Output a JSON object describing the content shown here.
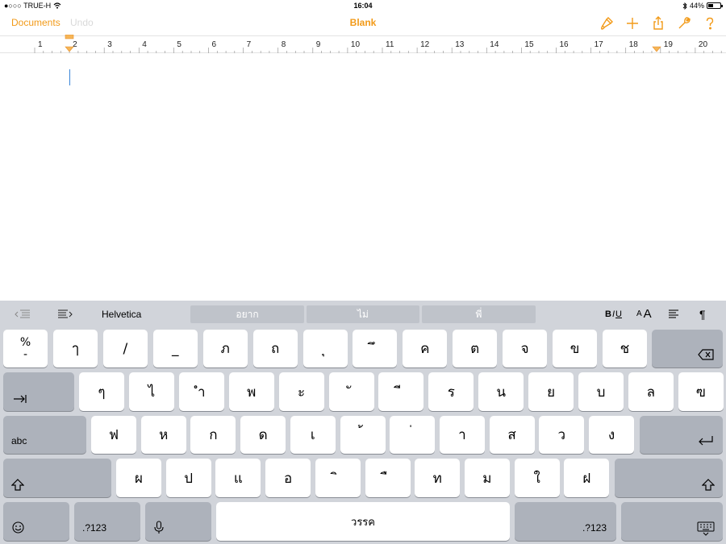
{
  "status": {
    "carrier": "●○○○ TRUE-H",
    "time": "16:04",
    "battery_pct": "44%",
    "battery_level": 0.44
  },
  "nav": {
    "documents": "Documents",
    "undo": "Undo",
    "title": "Blank"
  },
  "ruler": {
    "numbers": [
      "1",
      "2",
      "3",
      "4",
      "5",
      "6",
      "7",
      "8",
      "9",
      "10",
      "11",
      "12",
      "13",
      "14",
      "15",
      "16",
      "17",
      "18",
      "19",
      "20"
    ]
  },
  "shortcut": {
    "font": "Helvetica",
    "bold": "B",
    "italic": "I",
    "underline": "U",
    "size_small": "A",
    "size_large": "A",
    "pilcrow": "¶"
  },
  "suggestions": [
    "อยาก",
    "ไม่",
    "พี่"
  ],
  "keys": {
    "row1": [
      "ๅ",
      "/",
      "_",
      "ภ",
      "ถ",
      "ุ",
      "ึ",
      "ค",
      "ต",
      "จ",
      "ข",
      "ช"
    ],
    "percent_top": "%",
    "percent_bottom": "-",
    "row2": [
      "ๆ",
      "ไ",
      "ำ",
      "พ",
      "ะ",
      "ั",
      "ี",
      "ร",
      "น",
      "ย",
      "บ",
      "ล",
      "ฃ"
    ],
    "row3": [
      "ฟ",
      "ห",
      "ก",
      "ด",
      "เ",
      "้",
      "่",
      "า",
      "ส",
      "ว",
      "ง"
    ],
    "row4": [
      "ผ",
      "ป",
      "แ",
      "อ",
      "ิ",
      "ื",
      "ท",
      "ม",
      "ใ",
      "ฝ"
    ],
    "abc": "abc",
    "num_left": ".?123",
    "num_right": ".?123",
    "space": "วรรค"
  },
  "colors": {
    "accent": "#f29a18",
    "cursor": "#3a86d8",
    "keyboard_bg": "#d1d4da",
    "key_gray": "#adb2bb"
  }
}
